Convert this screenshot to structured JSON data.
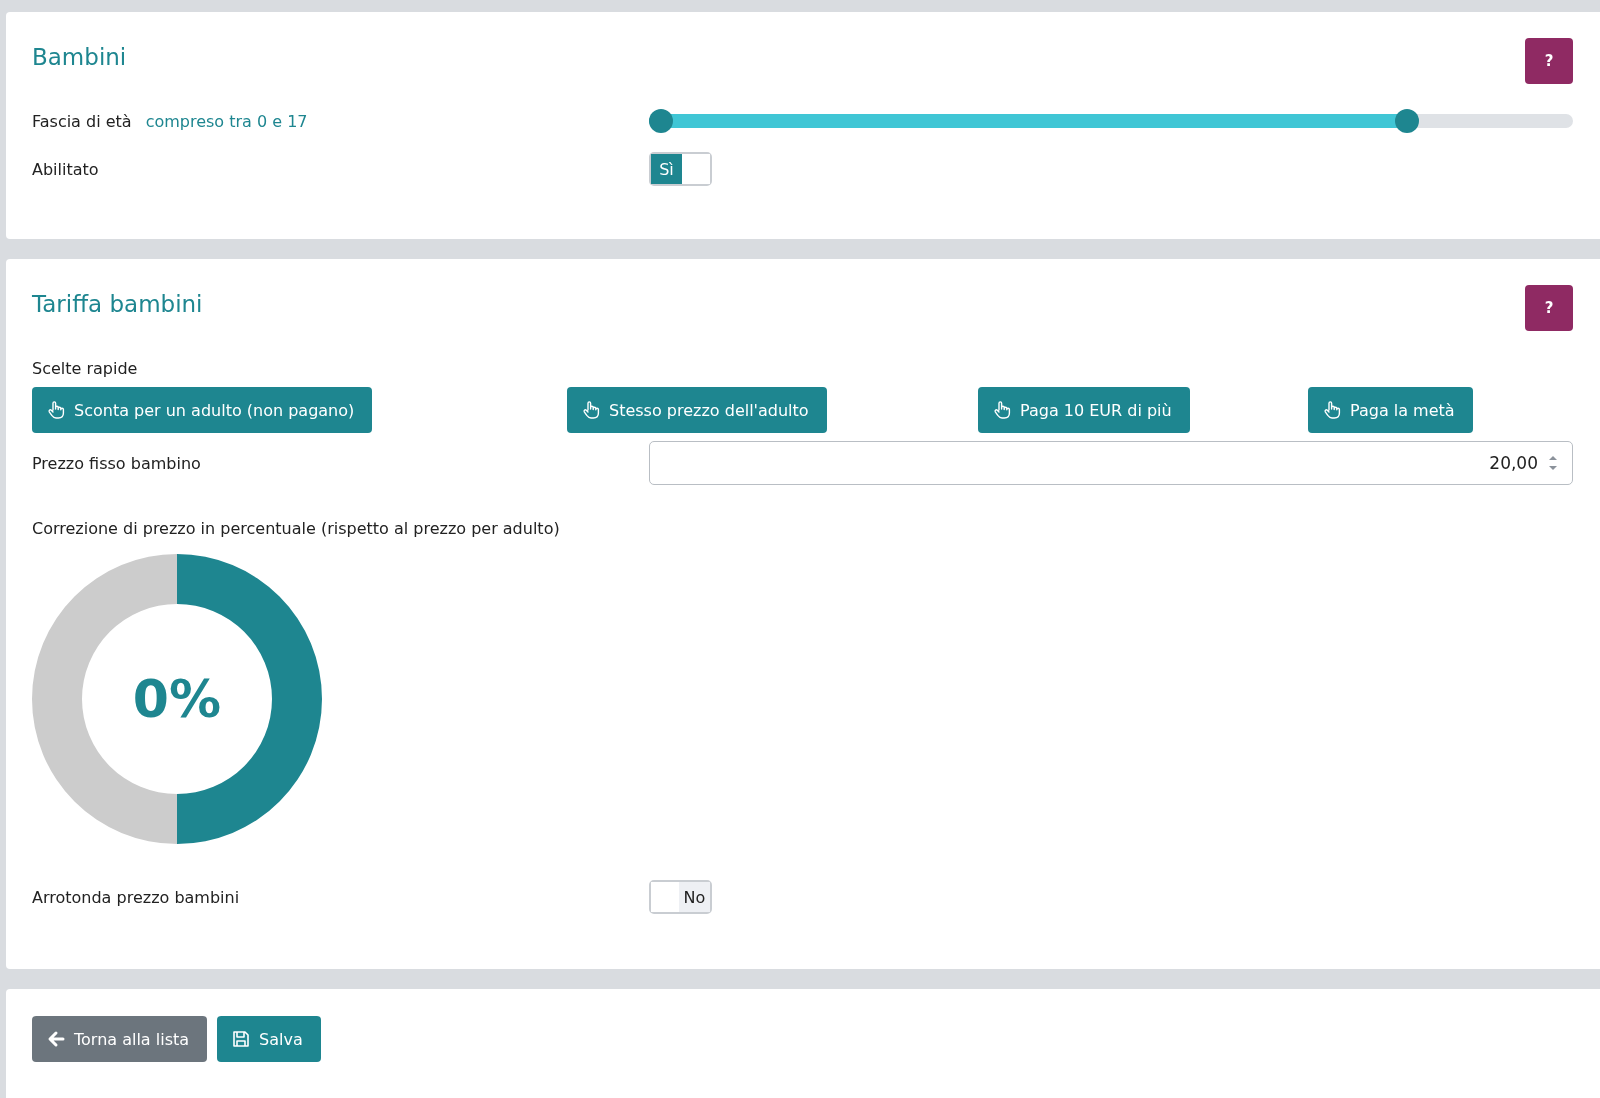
{
  "sections": [
    {
      "title": "Bambini",
      "help": "?",
      "age_range": {
        "label": "Fascia di età",
        "value": "compreso tra 0 e 17",
        "level": 0.82
      },
      "enabled": {
        "label": "Abilitato",
        "on": true,
        "text": "Sì"
      }
    },
    {
      "title": "Tariffa bambini",
      "help": "?",
      "quick_label": "Scelte rapide",
      "quick_choices": [
        "Sconta per un adulto (non pagano)",
        "Stesso prezzo dell'adulto",
        "Paga 10 EUR di più",
        "Paga la metà"
      ],
      "fixed_price": {
        "label": "Prezzo fisso bambino",
        "value": "20,00"
      },
      "correction": {
        "label": "Correzione di prezzo in percentuale (rispetto al prezzo per adulto)",
        "value": "0%"
      },
      "rounding": {
        "label": "Arrotonda prezzo bambini",
        "on": false,
        "text": "No"
      }
    }
  ],
  "actions": [
    {
      "kind": "back",
      "label": "Torna alla lista"
    },
    {
      "kind": "save",
      "label": "Salva"
    }
  ]
}
